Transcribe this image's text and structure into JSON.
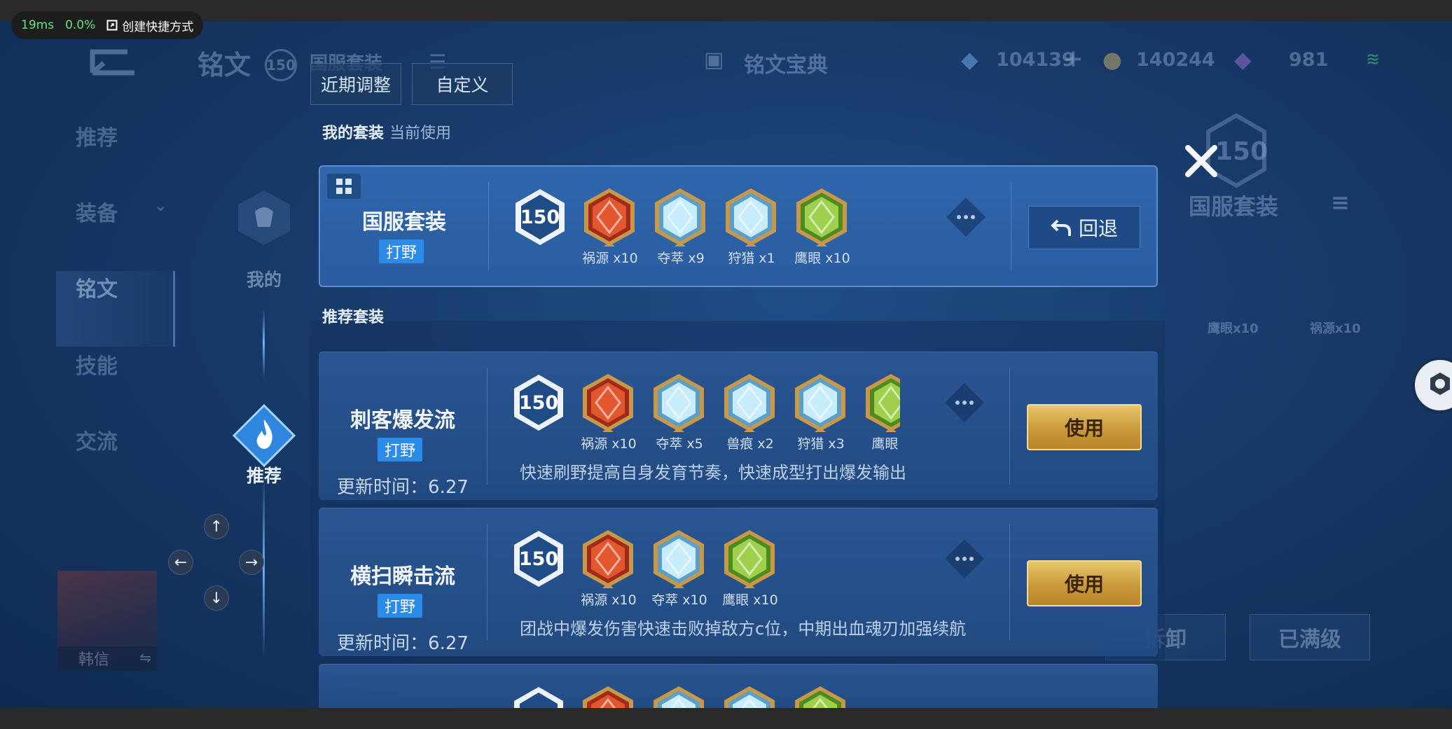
{
  "perf": {
    "latency": "19ms",
    "loss": "0.0%",
    "shortcut": "创建快捷方式"
  },
  "header": {
    "title": "铭文",
    "level": "150",
    "set_name": "国服套装",
    "codex": "铭文宝典",
    "currency1": "104139",
    "currency2": "140244",
    "currency3": "981"
  },
  "sidebar": {
    "items": [
      "推荐",
      "装备",
      "铭文",
      "技能",
      "交流"
    ]
  },
  "hero": {
    "name": "韩信"
  },
  "tabs": {
    "recent": "近期调整",
    "custom": "自定义"
  },
  "left_nav": {
    "mine": "我的",
    "recommend": "推荐"
  },
  "my_set": {
    "section": "我的套装",
    "section_sub": "当前使用",
    "name": "国服套装",
    "tag": "打野",
    "level": "150",
    "gems": [
      {
        "label": "祸源 x10",
        "color": "red"
      },
      {
        "label": "夺萃 x9",
        "color": "blue"
      },
      {
        "label": "狩猎 x1",
        "color": "blue"
      },
      {
        "label": "鹰眼 x10",
        "color": "green"
      }
    ],
    "back_label": "回退"
  },
  "recommended": {
    "section": "推荐套装",
    "sets": [
      {
        "name": "刺客爆发流",
        "tag": "打野",
        "updated": "更新时间：6.27",
        "level": "150",
        "desc": "快速刷野提高自身发育节奏，快速成型打出爆发输出",
        "gems": [
          {
            "label": "祸源 x10",
            "color": "red"
          },
          {
            "label": "夺萃 x5",
            "color": "blue"
          },
          {
            "label": "兽痕 x2",
            "color": "blue"
          },
          {
            "label": "狩猎 x3",
            "color": "blue"
          },
          {
            "label": "鹰眼：",
            "color": "green"
          }
        ],
        "use_label": "使用"
      },
      {
        "name": "横扫瞬击流",
        "tag": "打野",
        "updated": "更新时间：6.27",
        "level": "150",
        "desc": "团战中爆发伤害快速击败掉敌方c位，中期出血魂刃加强续航",
        "gems": [
          {
            "label": "祸源 x10",
            "color": "red"
          },
          {
            "label": "夺萃 x10",
            "color": "blue"
          },
          {
            "label": "鹰眼 x10",
            "color": "green"
          }
        ],
        "use_label": "使用"
      }
    ]
  },
  "right_panel": {
    "level": "150",
    "set_name": "国服套装",
    "gem_labels": [
      "鹰眼x10",
      "祸源x10"
    ],
    "disassemble": "拆卸",
    "maxed": "已满级"
  },
  "colors": {
    "gem_red": "#d84a2a",
    "gem_blue": "#9fd3ef",
    "gem_green": "#7fbf3a",
    "gold": "#d4a94a",
    "tag_blue": "#2c8ae8"
  }
}
